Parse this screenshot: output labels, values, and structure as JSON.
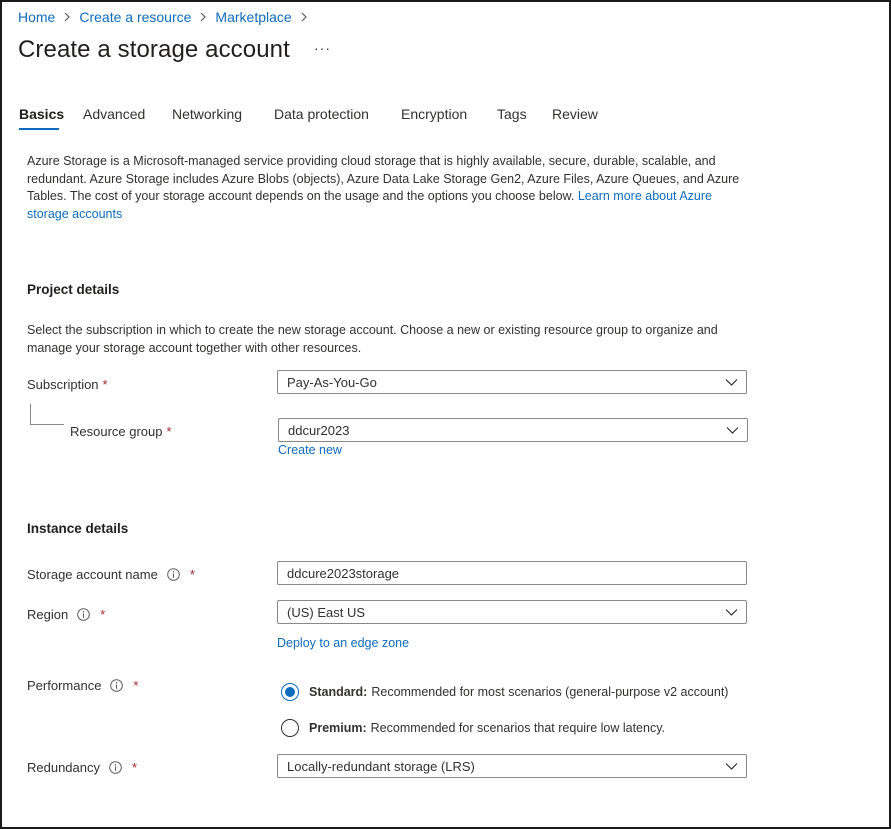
{
  "breadcrumb": {
    "items": [
      "Home",
      "Create a resource",
      "Marketplace"
    ]
  },
  "page": {
    "title": "Create a storage account",
    "more": "···"
  },
  "tabs": [
    "Basics",
    "Advanced",
    "Networking",
    "Data protection",
    "Encryption",
    "Tags",
    "Review"
  ],
  "intro": {
    "text": "Azure Storage is a Microsoft-managed service providing cloud storage that is highly available, secure, durable, scalable, and redundant. Azure Storage includes Azure Blobs (objects), Azure Data Lake Storage Gen2, Azure Files, Azure Queues, and Azure Tables. The cost of your storage account depends on the usage and the options you choose below.",
    "link": "Learn more about Azure storage accounts"
  },
  "project": {
    "heading": "Project details",
    "description": "Select the subscription in which to create the new storage account. Choose a new or existing resource group to organize and manage your storage account together with other resources.",
    "subscription": {
      "label": "Subscription",
      "value": "Pay-As-You-Go"
    },
    "resource_group": {
      "label": "Resource group",
      "value": "ddcur2023",
      "create_new": "Create new"
    }
  },
  "instance": {
    "heading": "Instance details",
    "name": {
      "label": "Storage account name",
      "value": "ddcure2023storage"
    },
    "region": {
      "label": "Region",
      "value": "(US) East US",
      "edge_link": "Deploy to an edge zone"
    },
    "performance": {
      "label": "Performance",
      "options": [
        {
          "title": "Standard:",
          "desc": "Recommended for most scenarios (general-purpose v2 account)",
          "selected": true
        },
        {
          "title": "Premium:",
          "desc": "Recommended for scenarios that require low latency.",
          "selected": false
        }
      ]
    },
    "redundancy": {
      "label": "Redundancy",
      "value": "Locally-redundant storage (LRS)"
    }
  },
  "required_mark": "*",
  "colors": {
    "accent": "#0f6cbd",
    "required": "#a4262c",
    "text": "#323130"
  },
  "icons": {
    "info": "info-icon",
    "chevron": "chevron-down-icon",
    "separator": "chevron-right-icon"
  }
}
